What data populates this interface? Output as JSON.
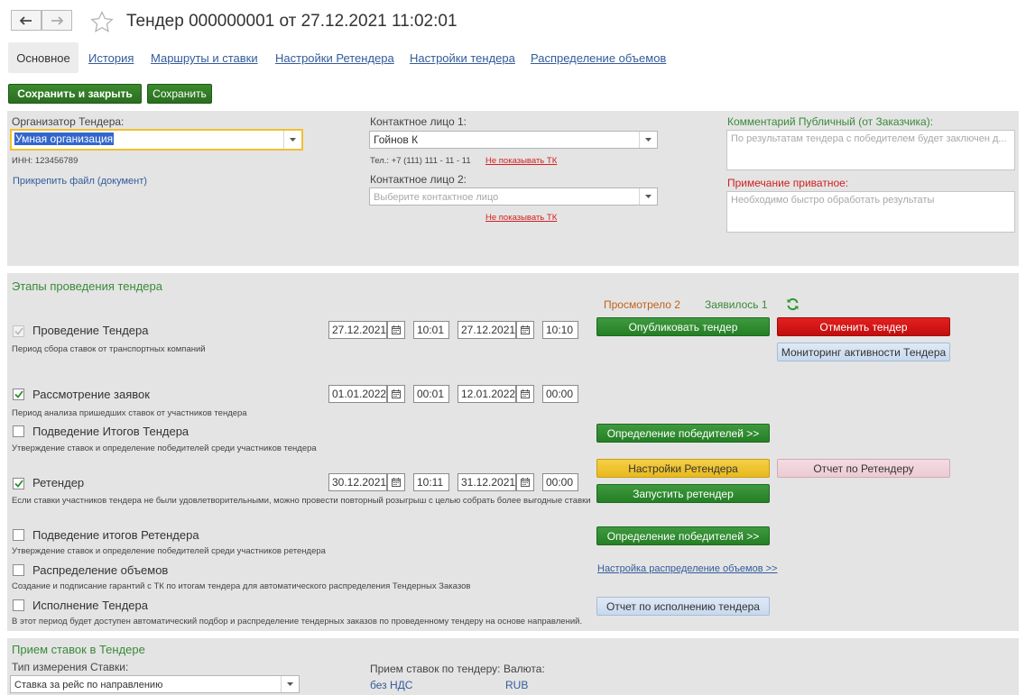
{
  "header": {
    "title": "Тендер 000000001 от 27.12.2021 11:02:01"
  },
  "tabs": [
    {
      "label": "Основное"
    },
    {
      "label": "История"
    },
    {
      "label": "Маршруты и ставки"
    },
    {
      "label": "Настройки Ретендера"
    },
    {
      "label": "Настройки тендера"
    },
    {
      "label": "Распределение объемов"
    }
  ],
  "toolbar": {
    "save_close_label": "Сохранить и закрыть",
    "save_label": "Сохранить"
  },
  "organizer": {
    "label": "Организатор Тендера:",
    "value": "Умная организация",
    "inn": "ИНН:  123456789",
    "attach_link": "Прикрепить файл (документ)"
  },
  "contacts": {
    "contact1_label": "Контактное лицо 1:",
    "contact1_value": "Гойнов К",
    "phone": "Тел.: +7 (111) 111 - 11 - 11",
    "hide_tk_1": "Не показывать ТК",
    "contact2_label": "Контактное лицо 2:",
    "contact2_placeholder": "Выберите контактное лицо",
    "hide_tk_2": "Не показывать ТК"
  },
  "comments": {
    "public_label": "Комментарий Публичный (от Заказчика):",
    "public_placeholder": "По результатам тендера с победителем будет заключен д...",
    "private_label": "Примечание приватное:",
    "private_placeholder": "Необходимо быстро обработать результаты"
  },
  "stages": {
    "section_title": "Этапы проведения тендера",
    "viewed": "Просмотрело 2",
    "appeared": "Заявилось 1",
    "items": [
      {
        "title": "Проведение Тендера",
        "desc": "Период сбора ставок от транспортных компаний",
        "checked": true,
        "date_from": "27.12.2021",
        "time_from": "10:01",
        "date_to": "27.12.2021",
        "time_to": "10:10"
      },
      {
        "title": "Рассмотрение заявок",
        "desc": "Период анализа пришедших ставок от участников тендера",
        "checked": true,
        "date_from": "01.01.2022",
        "time_from": "00:01",
        "date_to": "12.01.2022",
        "time_to": "00:00"
      },
      {
        "title": "Подведение Итогов Тендера",
        "desc": "Утверждение ставок и определение победителей среди участников тендера",
        "checked": false
      },
      {
        "title": "Ретендер",
        "desc": "Если ставки участников тендера не были удовлетворительными, можно провести повторный розыгрыш с целью собрать более выгодные ставки",
        "checked": true,
        "date_from": "30.12.2021",
        "time_from": "10:11",
        "date_to": "31.12.2021",
        "time_to": "00:00"
      },
      {
        "title": "Подведение итогов Ретендера",
        "desc": "Утверждение ставок и определение победителей среди участников ретендера",
        "checked": false
      },
      {
        "title": "Распределение объемов",
        "desc": "Создание и подписание гарантий с ТК по итогам тендера для автоматического распределения Тендерных Заказов",
        "checked": false
      },
      {
        "title": "Исполнение Тендера",
        "desc": "В этот период будет доступен автоматический подбор и распределение тендерных заказов по проведенному тендеру на основе направлений.",
        "checked": false
      }
    ],
    "buttons": {
      "publish": "Опубликовать тендер",
      "cancel": "Отменить тендер",
      "monitoring": "Мониторинг активности Тендера",
      "winners1": "Определение победителей >>",
      "retender_settings": "Настройки Ретендера",
      "retender_report": "Отчет по Ретендеру",
      "start_retender": "Запустить ретендер",
      "winners2": "Определение победителей >>",
      "volume_link": "Настройка распределение объемов >>",
      "execution_report": "Отчет по исполнению тендера"
    }
  },
  "bids": {
    "section_title": "Прием ставок в Тендере",
    "type_label": "Тип измерения Ставки:",
    "type_value": "Ставка за рейс по направлению",
    "accept_label": "Прием ставок по тендеру:",
    "accept_value": "без НДС",
    "currency_label": "Валюта:",
    "currency_value": "RUB"
  }
}
